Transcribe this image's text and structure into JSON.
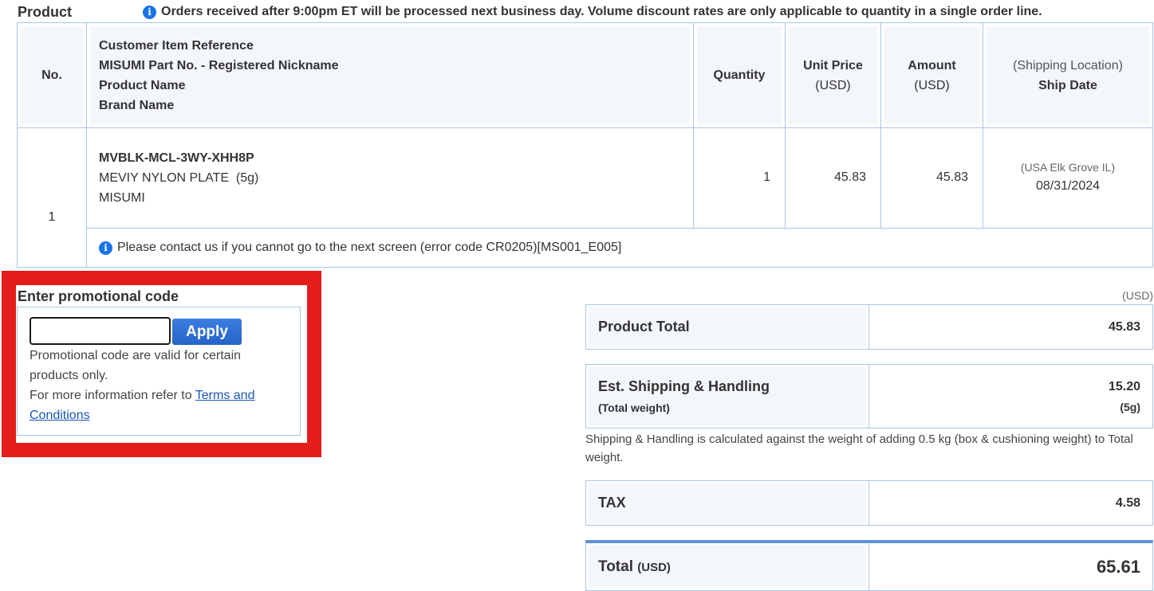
{
  "section_title": "Product",
  "notice": {
    "icon": "info-icon",
    "text": "Orders received after 9:00pm ET will be processed next business day. Volume discount rates are only applicable to quantity in a single order line."
  },
  "table": {
    "headers": {
      "no": "No.",
      "desc": [
        "Customer Item Reference",
        "MISUMI Part No. - Registered Nickname",
        "Product Name",
        "Brand Name"
      ],
      "quantity": "Quantity",
      "unit_price": "Unit Price",
      "unit_price_sub": "(USD)",
      "amount": "Amount",
      "amount_sub": "(USD)",
      "ship_location": "(Shipping Location)",
      "ship_date": "Ship Date"
    },
    "rows": [
      {
        "no": "1",
        "part_no": "MVBLK-MCL-3WY-XHH8P",
        "product_name": "MEVIY NYLON PLATE  (5g)",
        "brand": "MISUMI",
        "quantity": "1",
        "unit_price": "45.83",
        "amount": "45.83",
        "ship_location": "(USA Elk Grove IL)",
        "ship_date": "08/31/2024",
        "message": "Please contact us if you cannot go to the next screen (error code CR0205)[MS001_E005]"
      }
    ]
  },
  "promo": {
    "title": "Enter promotional code",
    "input_value": "",
    "apply_label": "Apply",
    "note1": "Promotional code are valid for certain products only.",
    "note2": "For more information refer to ",
    "link_label": "Terms and Conditions",
    "highlight_color": "#e31c1c"
  },
  "summary": {
    "currency_label": "(USD)",
    "product_total_label": "Product Total",
    "product_total_value": "45.83",
    "shipping_label": "Est. Shipping & Handling",
    "shipping_sub_label": "(Total weight)",
    "shipping_value": "15.20",
    "shipping_weight": "(5g)",
    "shipping_note": "Shipping & Handling is calculated against the weight of adding 0.5 kg (box & cushioning weight) to Total weight.",
    "tax_label": "TAX",
    "tax_value": "4.58",
    "total_label": "Total",
    "total_currency": "(USD)",
    "total_value": "65.61"
  },
  "colors": {
    "accent": "#2d6fd2",
    "border": "#a9c6e6",
    "header_bg": "#f3f6fb",
    "highlight": "#e31c1c"
  }
}
